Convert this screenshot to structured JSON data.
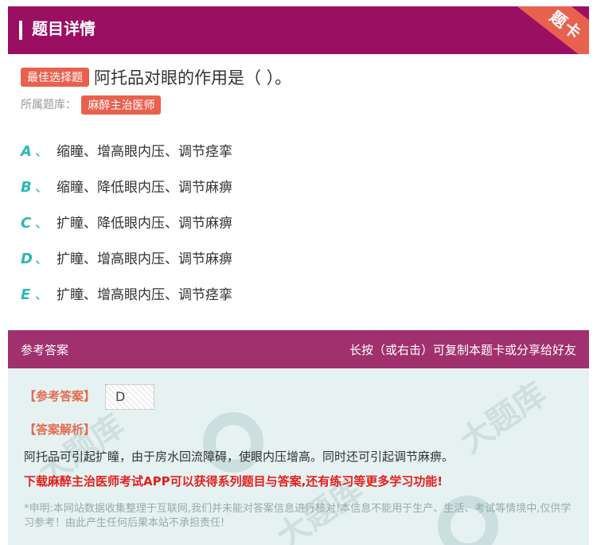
{
  "header": {
    "title": "题目详情",
    "corner_label": "题卡"
  },
  "question": {
    "type_tag": "最佳选择题",
    "text": "阿托品对眼的作用是（ ）。"
  },
  "bank": {
    "label": "所属题库：",
    "name": "麻醉主治医师"
  },
  "options": [
    {
      "letter": "A",
      "sep": "、",
      "text": "缩瞳、增高眼内压、调节痉挛"
    },
    {
      "letter": "B",
      "sep": "、",
      "text": "缩瞳、降低眼内压、调节麻痹"
    },
    {
      "letter": "C",
      "sep": "、",
      "text": "扩瞳、降低眼内压、调节麻痹"
    },
    {
      "letter": "D",
      "sep": "、",
      "text": "扩瞳、增高眼内压、调节麻痹"
    },
    {
      "letter": "E",
      "sep": "、",
      "text": "扩瞳、增高眼内压、调节痉挛"
    }
  ],
  "answer_bar": {
    "left": "参考答案",
    "right": "长按（或右击）可复制本题卡或分享给好友"
  },
  "answer": {
    "label": "【参考答案】",
    "value": "D",
    "analysis_label": "【答案解析】",
    "analysis": "阿托品可引起扩瞳，由于房水回流障碍，使眼内压增高。同时还可引起调节麻痹。",
    "promo": "下载麻醉主治医师考试APP可以获得系列题目与答案,还有练习等更多学习功能!",
    "notice": "*申明:本网站数据收集整理于互联网,我们并未能对答案信息进行核对!本信息不能用于生产、生活、考试等情境中,仅供学习参考！由此产生任何后果本站不承担责任!"
  },
  "colors": {
    "header": "#9b0f63",
    "accent": "#e8614f",
    "option_letter": "#2bb8b3",
    "answer_bar": "#a1306f",
    "promo": "#e4201f"
  }
}
